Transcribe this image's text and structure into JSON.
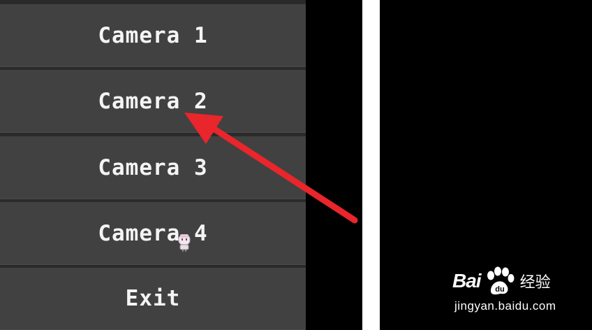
{
  "menu": {
    "items": [
      {
        "label": "Camera 1"
      },
      {
        "label": "Camera 2"
      },
      {
        "label": "Camera 3"
      },
      {
        "label": "Camera 4"
      },
      {
        "label": "Exit"
      }
    ]
  },
  "annotation": {
    "type": "arrow",
    "color": "#e8262b",
    "points_to": "Camera 2"
  },
  "watermark": {
    "brand_left": "Bai",
    "brand_right": "du",
    "brand_cn": "经验",
    "url": "jingyan.baidu.com",
    "icon": "paw-icon"
  },
  "colors": {
    "button_bg": "#414141",
    "button_text": "#f4f4f4",
    "background": "#000000",
    "divider": "#ffffff"
  }
}
